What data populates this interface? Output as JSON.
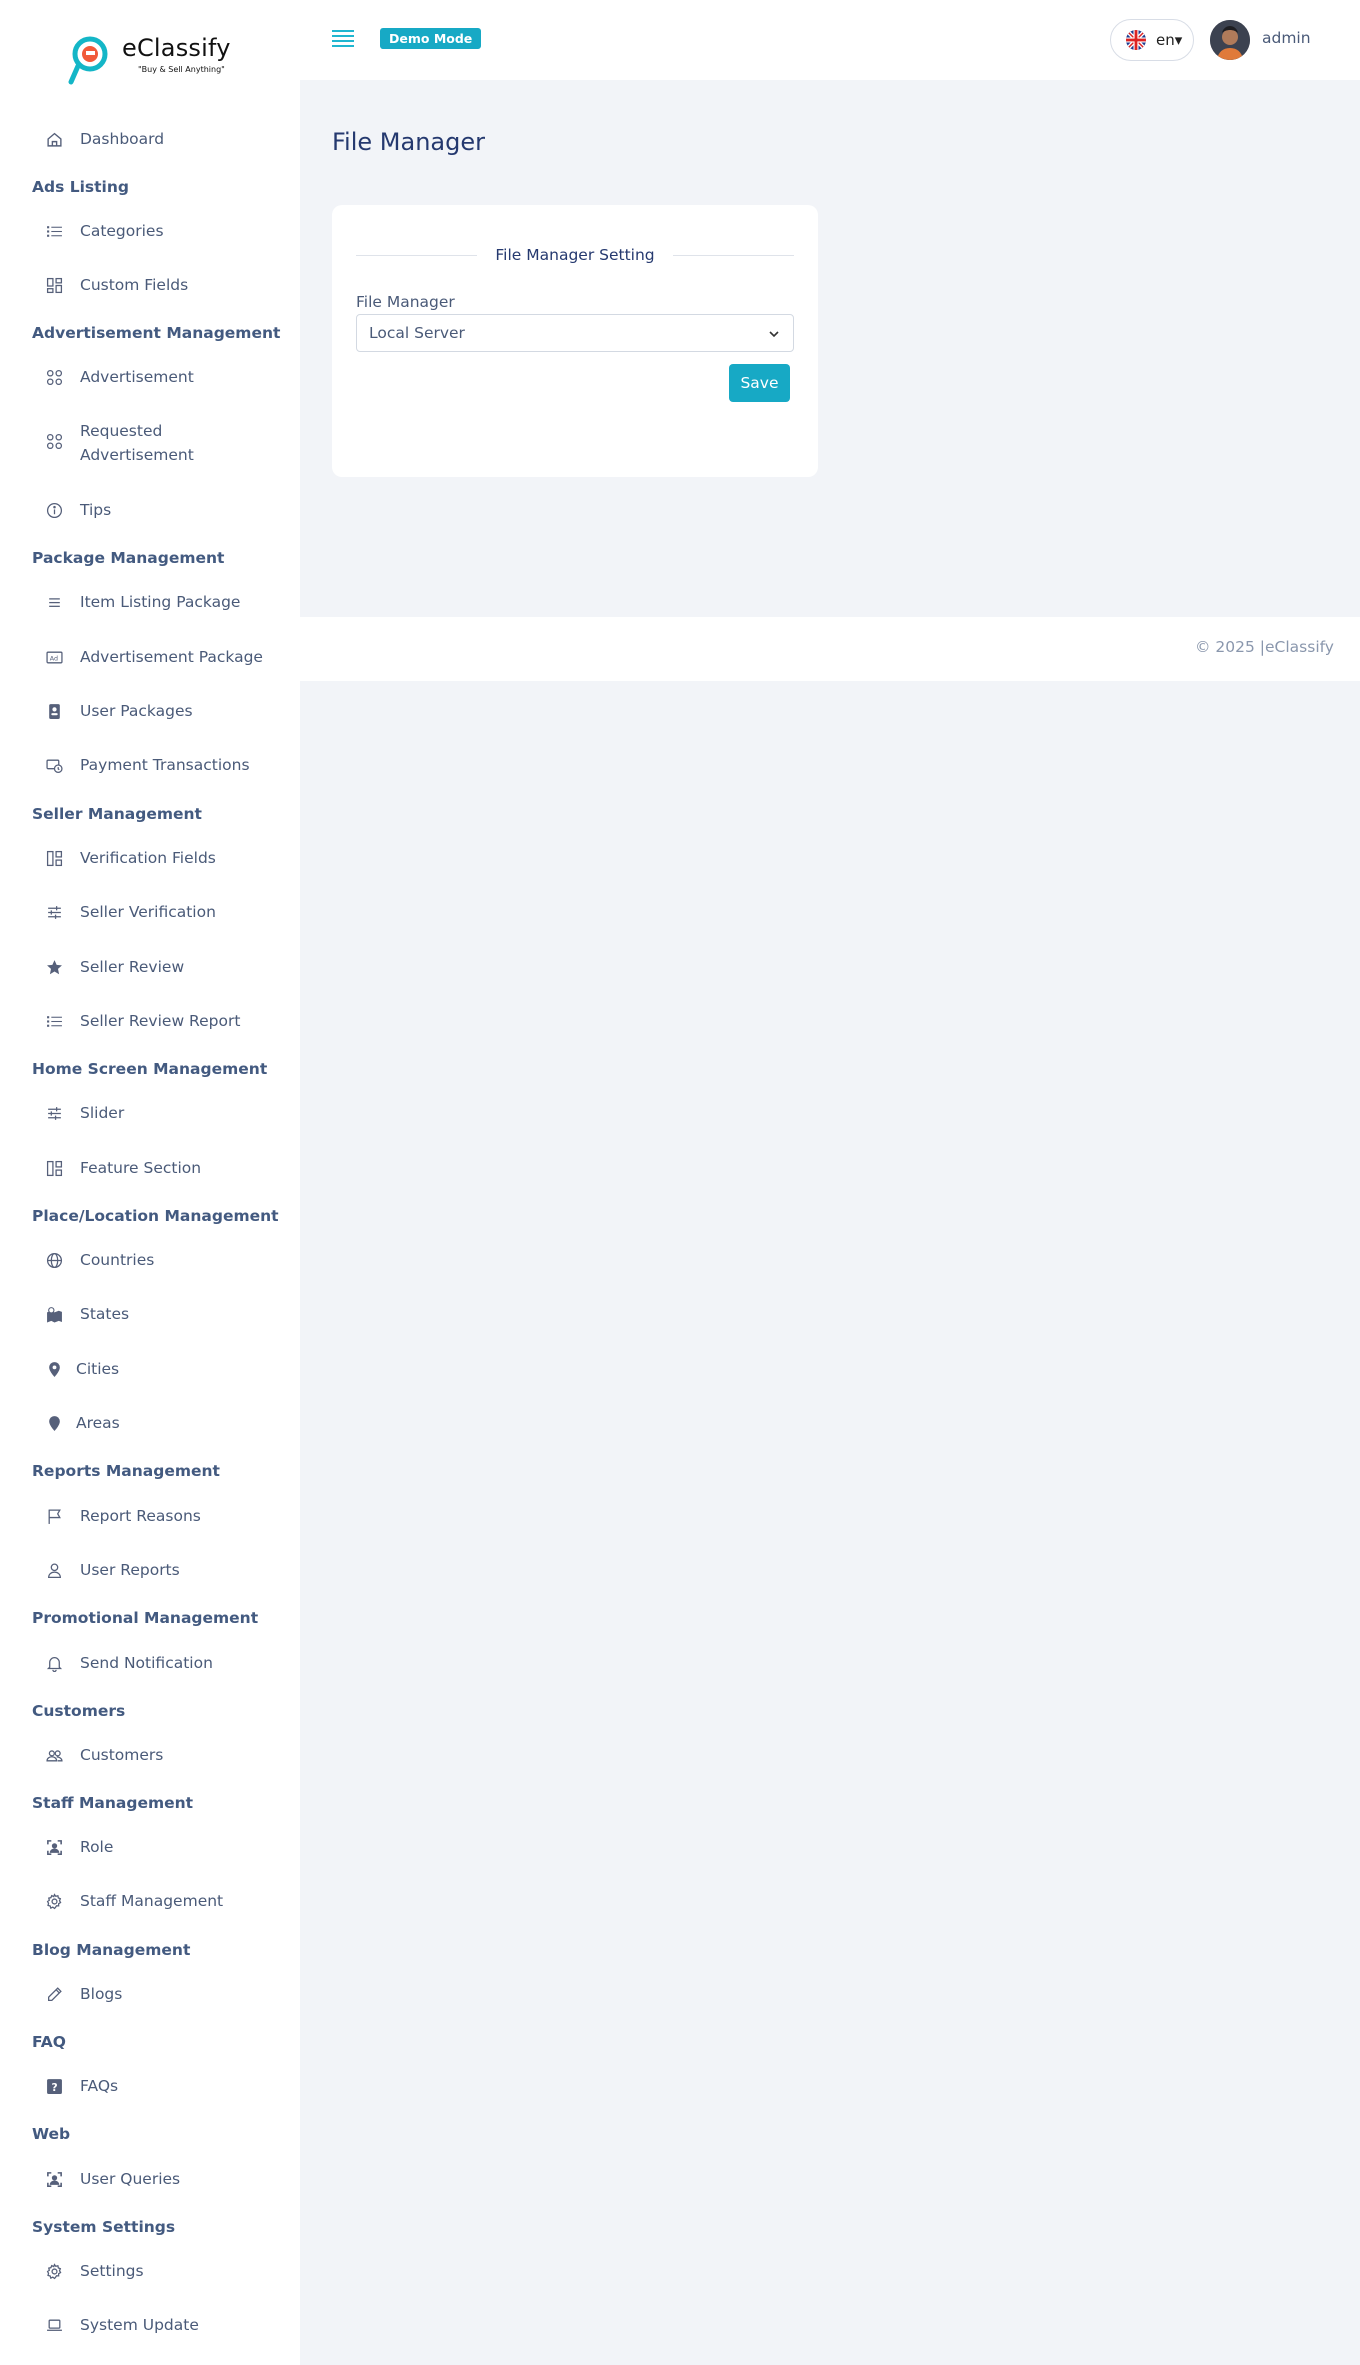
{
  "brand": {
    "name": "eClassify",
    "tagline": "\"Buy & Sell Anything\""
  },
  "topbar": {
    "demo_label": "Demo Mode",
    "language": "en▾",
    "user_name": "admin"
  },
  "sidebar": {
    "dashboard": "Dashboard",
    "sections": {
      "ads_listing": "Ads Listing",
      "advertisement_management": "Advertisement Management",
      "package_management": "Package Management",
      "seller_management": "Seller Management",
      "home_screen_management": "Home Screen Management",
      "place_location_management": "Place/Location Management",
      "reports_management": "Reports Management",
      "promotional_management": "Promotional Management",
      "customers": "Customers",
      "staff_management": "Staff Management",
      "blog_management": "Blog Management",
      "faq": "FAQ",
      "web": "Web",
      "system_settings": "System Settings"
    },
    "items": {
      "categories": "Categories",
      "custom_fields": "Custom Fields",
      "advertisement": "Advertisement",
      "requested_advertisement_1": "Requested",
      "requested_advertisement_2": "Advertisement",
      "tips": "Tips",
      "item_listing_package": "Item Listing Package",
      "advertisement_package": "Advertisement Package",
      "user_packages": "User Packages",
      "payment_transactions": "Payment Transactions",
      "verification_fields": "Verification Fields",
      "seller_verification": "Seller Verification",
      "seller_review": "Seller Review",
      "seller_review_report": "Seller Review Report",
      "slider": "Slider",
      "feature_section": "Feature Section",
      "countries": "Countries",
      "states": "States",
      "cities": "Cities",
      "areas": "Areas",
      "report_reasons": "Report Reasons",
      "user_reports": "User Reports",
      "send_notification": "Send Notification",
      "customers": "Customers",
      "role": "Role",
      "staff_management": "Staff Management",
      "blogs": "Blogs",
      "faqs": "FAQs",
      "user_queries": "User Queries",
      "settings": "Settings",
      "system_update": "System Update"
    }
  },
  "main": {
    "page_title": "File Manager",
    "card": {
      "title": "File Manager Setting",
      "field_label": "File Manager",
      "selected_value": "Local Server",
      "save_label": "Save"
    }
  },
  "footer": {
    "text": "© 2025 |eClassify"
  },
  "colors": {
    "accent": "#17a9c5",
    "page_bg": "#f2f4f8",
    "text": "#25396f"
  }
}
